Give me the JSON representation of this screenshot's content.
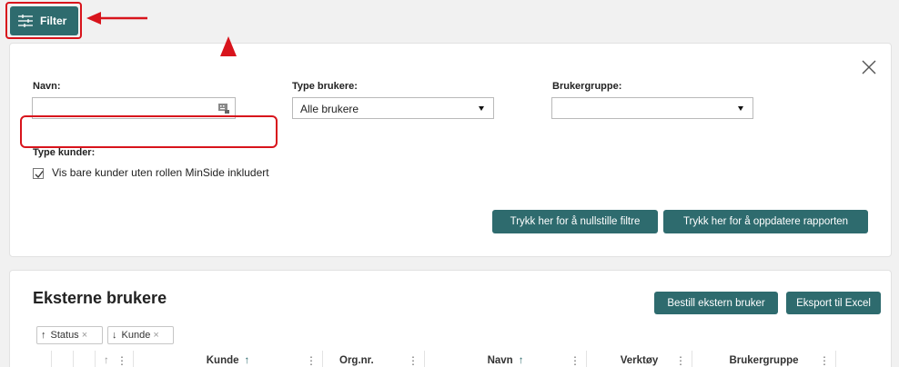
{
  "toolbar": {
    "filter_label": "Filter"
  },
  "filter_panel": {
    "name_label": "Navn:",
    "name_value": "",
    "user_type_label": "Type brukere:",
    "user_type_selected": "Alle brukere",
    "user_group_label": "Brukergruppe:",
    "user_group_selected": "",
    "customer_type_label": "Type kunder:",
    "checkbox_label": "Vis bare kunder uten rollen MinSide inkludert",
    "checkbox_checked": true,
    "reset_button": "Trykk her for å nullstille filtre",
    "update_button": "Trykk her for å oppdatere rapporten"
  },
  "table": {
    "title": "Eksterne brukere",
    "order_button": "Bestill ekstern bruker",
    "export_button": "Eksport til Excel",
    "sort_chips": [
      {
        "arrow": "↑",
        "label": "Status"
      },
      {
        "arrow": "↓",
        "label": "Kunde"
      }
    ],
    "columns": [
      {
        "label": "",
        "sort": ""
      },
      {
        "label": "",
        "sort": ""
      },
      {
        "label": "",
        "sort": "↑"
      },
      {
        "label": "Kunde",
        "sort": "↑"
      },
      {
        "label": "Org.nr.",
        "sort": ""
      },
      {
        "label": "Navn",
        "sort": "↑"
      },
      {
        "label": "Verktøy",
        "sort": ""
      },
      {
        "label": "Brukergruppe",
        "sort": ""
      }
    ]
  },
  "colors": {
    "accent": "#2e6b6e",
    "highlight": "#d8141c"
  }
}
